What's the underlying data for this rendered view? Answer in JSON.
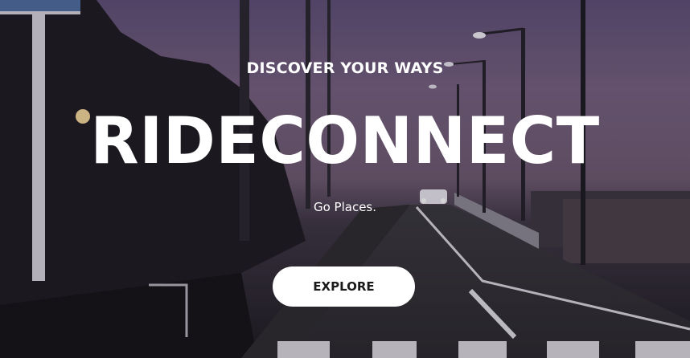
{
  "hero": {
    "tagline": "DISCOVER YOUR WAYS",
    "brand": "RIDECONNECT",
    "subtitle": "Go Places.",
    "cta_label": "EXPLORE"
  },
  "colors": {
    "text": "#ffffff",
    "button_bg": "#ffffff",
    "button_text": "#1a1a1a"
  }
}
